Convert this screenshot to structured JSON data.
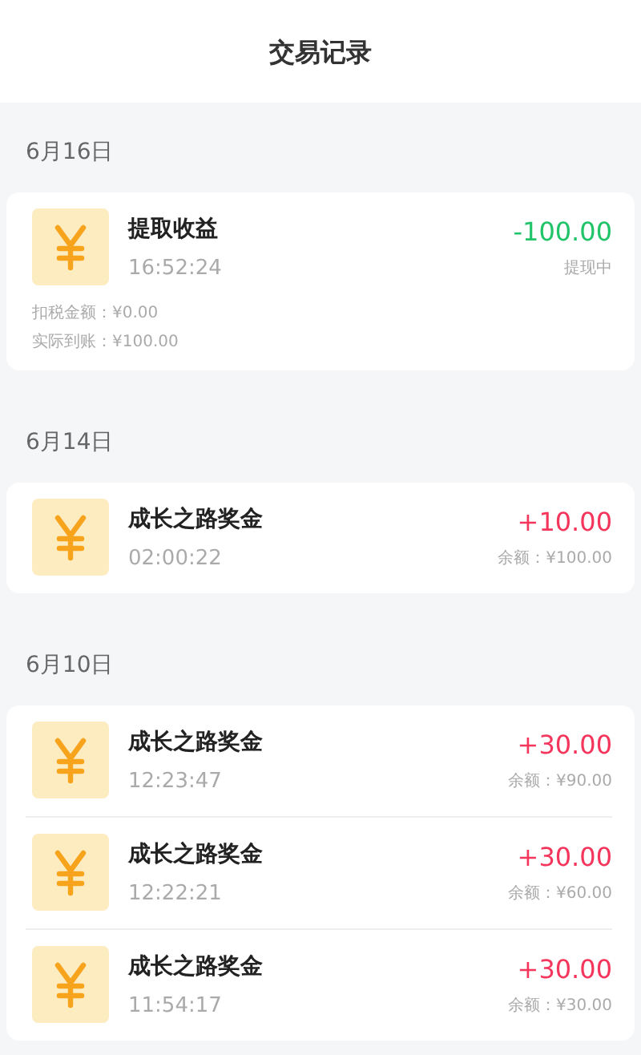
{
  "header": {
    "title": "交易记录"
  },
  "groups": [
    {
      "date": "6月16日",
      "items": [
        {
          "title": "提取收益",
          "time": "16:52:24",
          "amount": "-100.00",
          "color": "#22c46a",
          "note": "提现中",
          "details": [
            "扣税金额：¥0.00",
            "实际到账：¥100.00"
          ]
        }
      ]
    },
    {
      "date": "6月14日",
      "items": [
        {
          "title": "成长之路奖金",
          "time": "02:00:22",
          "amount": "+10.00",
          "color": "#f5365c",
          "note": "余额：¥100.00"
        }
      ]
    },
    {
      "date": "6月10日",
      "items": [
        {
          "title": "成长之路奖金",
          "time": "12:23:47",
          "amount": "+30.00",
          "color": "#f5365c",
          "note": "余额：¥90.00"
        },
        {
          "title": "成长之路奖金",
          "time": "12:22:21",
          "amount": "+30.00",
          "color": "#f5365c",
          "note": "余额：¥60.00"
        },
        {
          "title": "成长之路奖金",
          "time": "11:54:17",
          "amount": "+30.00",
          "color": "#f5365c",
          "note": "余额：¥30.00"
        }
      ]
    }
  ]
}
